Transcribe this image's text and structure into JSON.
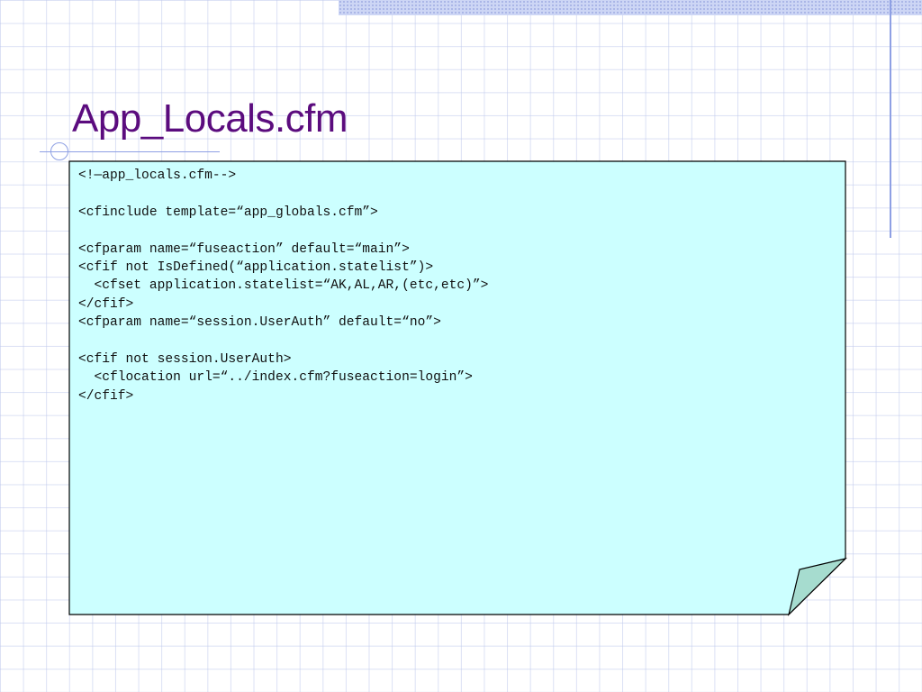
{
  "slide": {
    "title": "App_Locals.cfm",
    "title_color": "#5b0c7e",
    "note_fill": "#ccffff"
  },
  "code": {
    "lines": [
      "<!—app_locals.cfm-->",
      "",
      "<cfinclude template=“app_globals.cfm”>",
      "",
      "<cfparam name=“fuseaction” default=“main”>",
      "<cfif not IsDefined(“application.statelist”)>",
      "  <cfset application.statelist=“AK,AL,AR,(etc,etc)”>",
      "</cfif>",
      "<cfparam name=“session.UserAuth” default=“no”>",
      "",
      "<cfif not session.UserAuth>",
      "  <cflocation url=“../index.cfm?fuseaction=login”>",
      "</cfif>"
    ]
  }
}
